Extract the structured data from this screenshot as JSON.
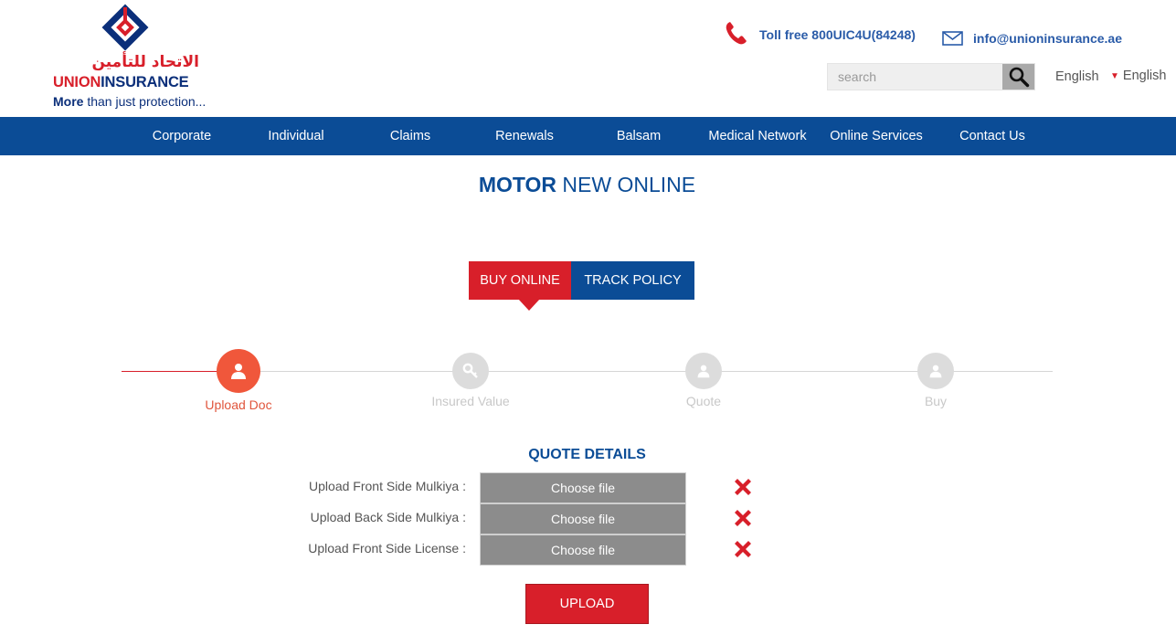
{
  "logo": {
    "arabic": "الاتحاد للتأمين",
    "name_part1": "UNION",
    "name_part2": "INSURANCE",
    "tagline_bold": "More",
    "tagline_rest": " than just protection..."
  },
  "contact": {
    "phone": "Toll free 800UIC4U(84248)",
    "email": "info@unioninsurance.ae"
  },
  "search": {
    "placeholder": "search"
  },
  "language": {
    "current": "English",
    "selector": "English"
  },
  "nav": {
    "items": [
      "Corporate",
      "Individual",
      "Claims",
      "Renewals",
      "Balsam",
      "Medical Network",
      "Online Services",
      "Contact Us"
    ]
  },
  "title": {
    "bold": "MOTOR",
    "rest": " NEW ONLINE"
  },
  "tabs": {
    "buy": "BUY ONLINE",
    "track": "TRACK POLICY"
  },
  "steps": [
    {
      "label": "Upload Doc",
      "active": true
    },
    {
      "label": "Insured Value",
      "active": false
    },
    {
      "label": "Quote",
      "active": false
    },
    {
      "label": "Buy",
      "active": false
    }
  ],
  "quote": {
    "title": "QUOTE DETAILS",
    "uploads": [
      {
        "label": "Upload Front Side Mulkiya :",
        "button": "Choose file"
      },
      {
        "label": "Upload Back Side Mulkiya :",
        "button": "Choose file"
      },
      {
        "label": "Upload Front Side License :",
        "button": "Choose file"
      }
    ],
    "upload_button": "UPLOAD"
  },
  "colors": {
    "brand_blue": "#0b4c96",
    "brand_red": "#d81f2a",
    "active_step": "#f0573b",
    "inactive_step": "#dcdcdc"
  }
}
